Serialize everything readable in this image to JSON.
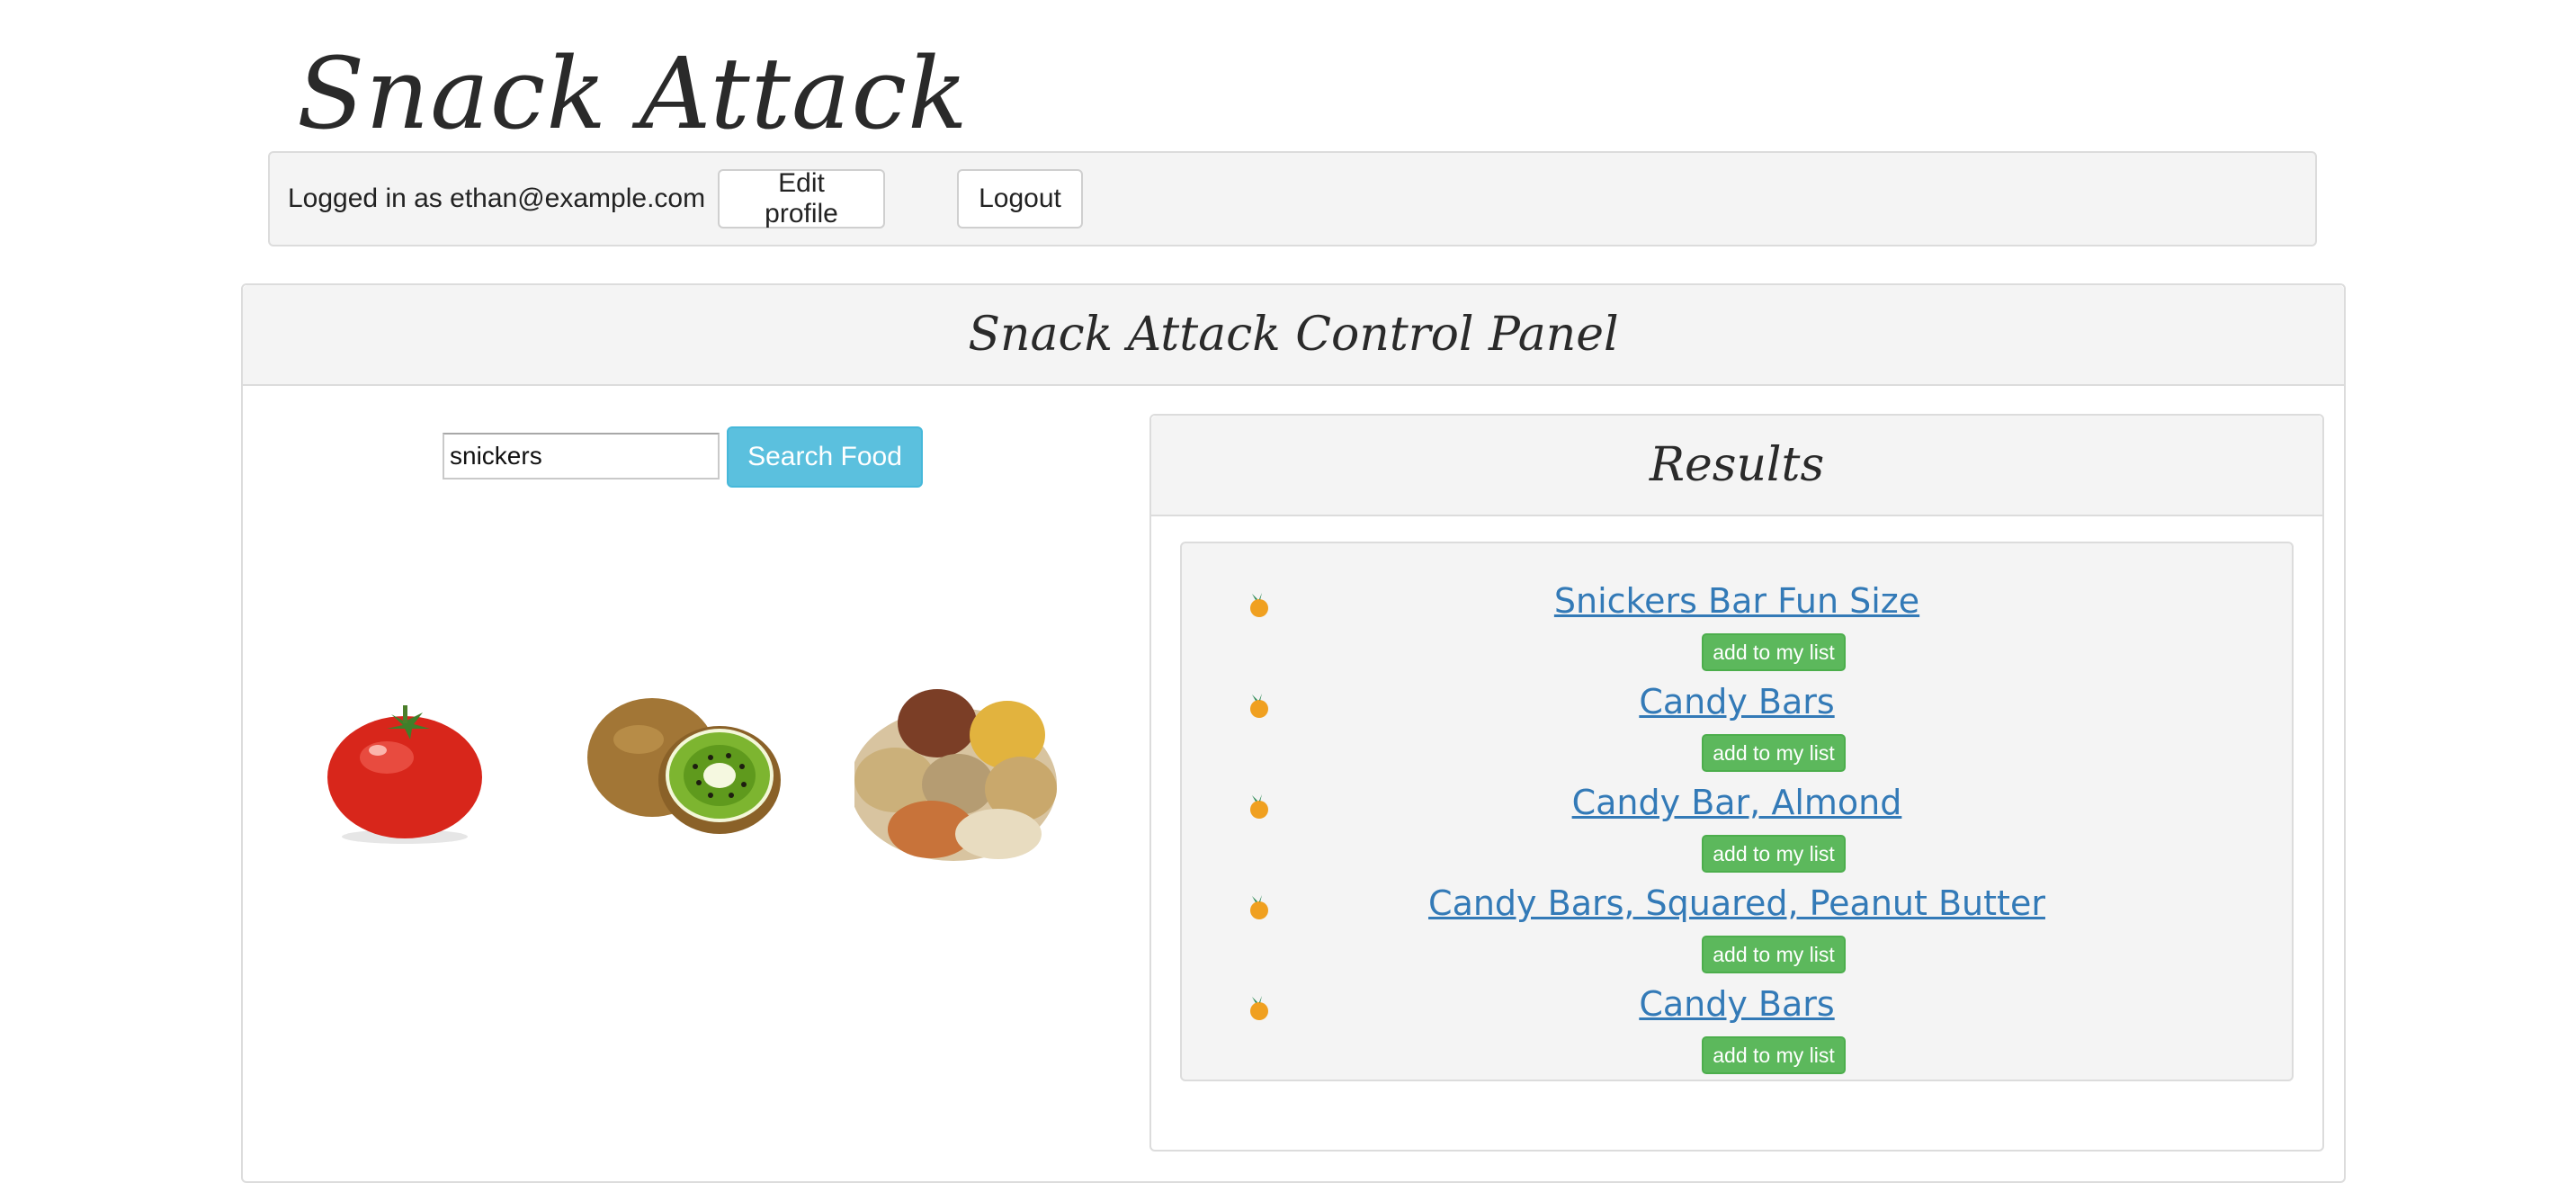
{
  "app": {
    "title": "Snack Attack"
  },
  "user_bar": {
    "logged_in_text": "Logged in as ethan@example.com",
    "edit_profile_label": "Edit profile",
    "logout_label": "Logout"
  },
  "control_panel": {
    "title": "Snack Attack Control Panel",
    "search": {
      "value": "snickers",
      "button_label": "Search Food"
    },
    "images": [
      "tomato",
      "kiwi",
      "grains"
    ]
  },
  "results": {
    "title": "Results",
    "add_label": "add to my list",
    "items": [
      {
        "name": "Snickers Bar Fun Size",
        "icon": "orange-icon"
      },
      {
        "name": "Candy Bars",
        "icon": "orange-icon"
      },
      {
        "name": "Candy Bar, Almond",
        "icon": "orange-icon"
      },
      {
        "name": "Candy Bars, Squared, Peanut Butter",
        "icon": "orange-icon"
      },
      {
        "name": "Candy Bars",
        "icon": "orange-icon"
      }
    ]
  },
  "colors": {
    "primary_info": "#5bc0de",
    "success": "#5cb85c",
    "link": "#337ab7",
    "panel_bg": "#f4f4f4"
  }
}
